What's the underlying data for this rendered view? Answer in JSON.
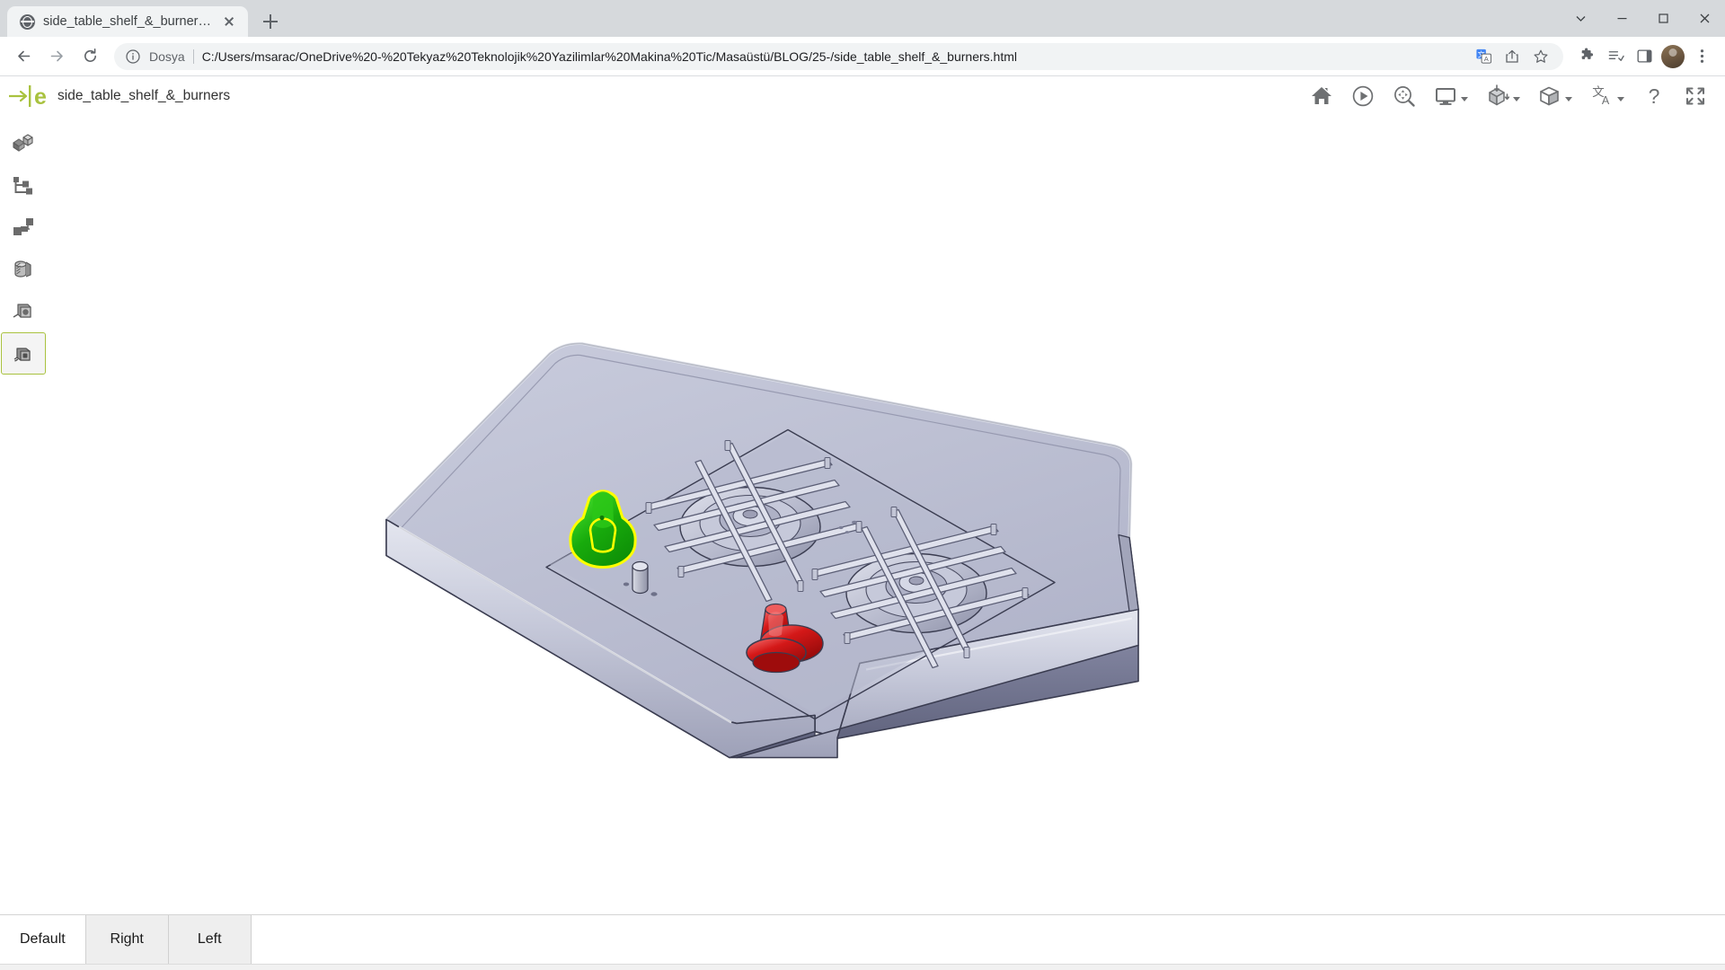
{
  "browser": {
    "tab": {
      "title": "side_table_shelf_&_burners.html",
      "favicon": "globe-icon",
      "close": "close-icon",
      "newtab": "plus-icon"
    },
    "window_controls": {
      "more": "chevron-down-icon",
      "minimize": "minimize-icon",
      "maximize": "maximize-icon",
      "close": "close-icon"
    },
    "nav": {
      "back": "back-arrow-icon",
      "forward": "forward-arrow-icon",
      "reload": "reload-icon"
    },
    "omnibox": {
      "info_icon": "info-circle-icon",
      "scheme_label": "Dosya",
      "url": "C:/Users/msarac/OneDrive%20-%20Tekyaz%20Teknolojik%20Yazilimlar%20Makina%20Tic/Masaüstü/BLOG/25-/side_table_shelf_&_burners.html",
      "translate_icon": "translate-icon",
      "share_icon": "share-icon",
      "bookmark_icon": "star-icon"
    },
    "toolbar_right": {
      "extensions": "puzzle-icon",
      "reading_list": "reading-list-icon",
      "side_panel": "side-panel-icon",
      "profile": "avatar",
      "menu": "kebab-menu-icon"
    }
  },
  "edrawings": {
    "logo": "edrawings-logo",
    "document_title": "side_table_shelf_&_burners",
    "toolbar": [
      {
        "name": "home-icon",
        "label": "Home",
        "caret": false
      },
      {
        "name": "play-icon",
        "label": "Play Animation",
        "caret": false
      },
      {
        "name": "zoom-fit-icon",
        "label": "Fit to Window",
        "caret": false
      },
      {
        "name": "display-icon",
        "label": "Display",
        "caret": true
      },
      {
        "name": "explode-cube-icon",
        "label": "Explode",
        "caret": true
      },
      {
        "name": "shaded-cube-icon",
        "label": "Shading",
        "caret": true
      },
      {
        "name": "translate-icon",
        "label": "Language",
        "caret": true
      },
      {
        "name": "help-icon",
        "label": "Help",
        "caret": false
      },
      {
        "name": "fullscreen-icon",
        "label": "Full Screen",
        "caret": false
      }
    ],
    "sidebar": [
      {
        "name": "sidebar-item-components",
        "icon": "components-icon",
        "selected": false
      },
      {
        "name": "sidebar-item-assembly",
        "icon": "tree-branch-icon",
        "selected": false
      },
      {
        "name": "sidebar-item-markup",
        "icon": "markup-blocks-icon",
        "selected": false
      },
      {
        "name": "sidebar-item-section",
        "icon": "section-cut-icon",
        "selected": false
      },
      {
        "name": "sidebar-item-measure",
        "icon": "measure-icon",
        "selected": false
      },
      {
        "name": "sidebar-item-camera",
        "icon": "camera-icon",
        "selected": true
      }
    ],
    "view_tabs": [
      {
        "label": "Default",
        "active": true
      },
      {
        "label": "Right",
        "active": false
      },
      {
        "label": "Left",
        "active": false
      }
    ],
    "model": {
      "description": "Isometric 3D shaded CAD view of a side table shelf with two gas burners",
      "colors": {
        "plate_top": "#b9bcd0",
        "plate_top_light": "#c9ccdd",
        "plate_edge": "#9a9db4",
        "plate_side": "#8a8da6",
        "plate_dark": "#5b5e78",
        "grate": "#d5d7e3",
        "grate_line": "#6b6e84",
        "burner_cap": "#c2c5d6",
        "outline": "#3a3c50",
        "selected_knob": "#22b014",
        "selected_knob_light": "#35d421",
        "selected_outline": "#ffff00",
        "red_knob": "#cc1212",
        "red_knob_light": "#e84a4a",
        "red_knob_dark": "#8f0a0a",
        "pin": "#b9bcc8"
      }
    }
  }
}
